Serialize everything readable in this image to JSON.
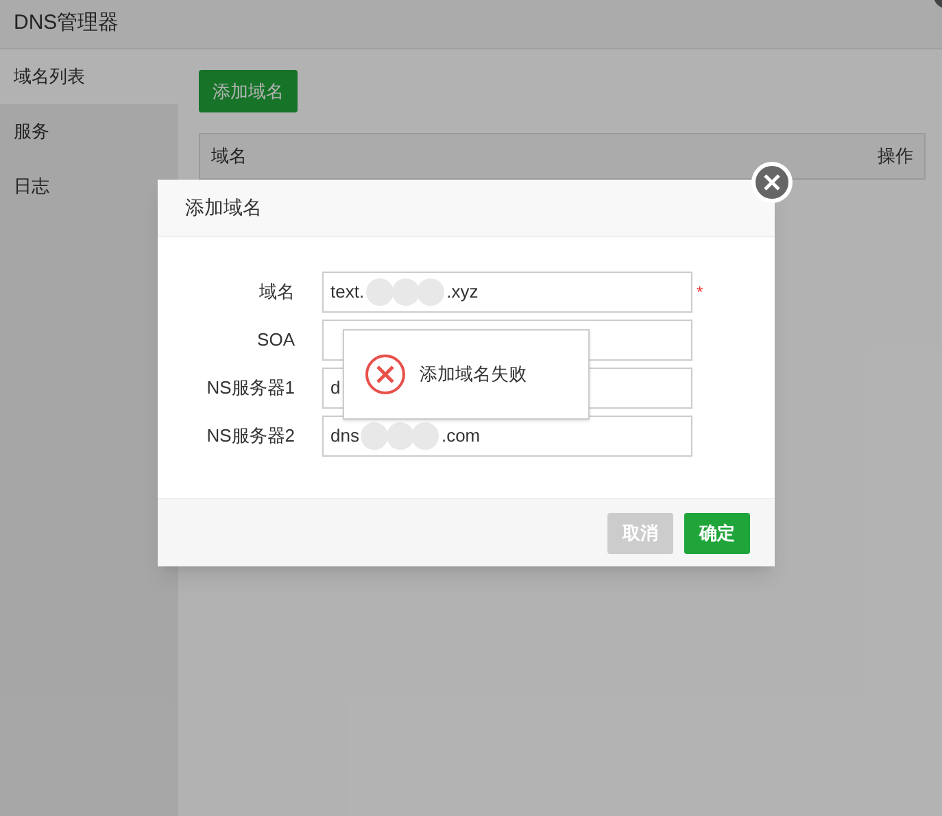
{
  "window": {
    "title": "DNS管理器"
  },
  "sidebar": {
    "items": [
      {
        "label": "域名列表",
        "selected": true
      },
      {
        "label": "服务",
        "selected": false
      },
      {
        "label": "日志",
        "selected": false
      }
    ]
  },
  "toolbar": {
    "add_button": "添加域名"
  },
  "table": {
    "columns": [
      "域名",
      "操作"
    ]
  },
  "dialog": {
    "title": "添加域名",
    "fields": [
      {
        "label": "域名",
        "value_start": "text.",
        "value_end": ".xyz",
        "required_mark": "*"
      },
      {
        "label": "SOA"
      },
      {
        "label": "NS服务器1",
        "value_start": "d"
      },
      {
        "label": "NS服务器2",
        "value_start": "dns",
        "value_end": ".com"
      }
    ],
    "buttons": [
      {
        "label": "取消",
        "disabled": true
      },
      {
        "label": "确定",
        "disabled": false
      }
    ]
  },
  "toast": {
    "kind": "error",
    "message": "添加域名失败"
  }
}
